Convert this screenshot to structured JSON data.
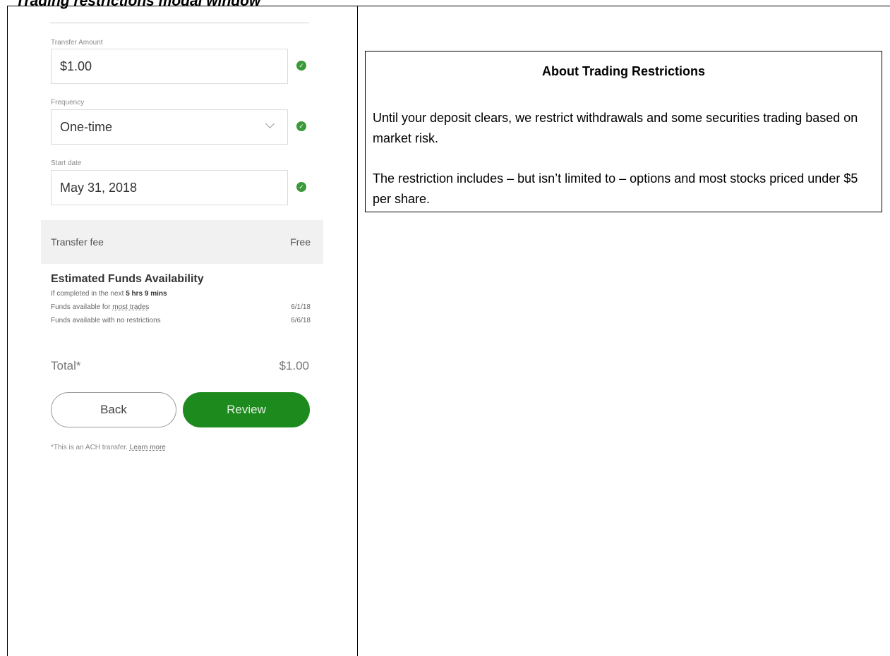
{
  "document": {
    "title": "Trading restrictions modal window"
  },
  "form": {
    "transfer_amount": {
      "label": "Transfer Amount",
      "value": "$1.00"
    },
    "frequency": {
      "label": "Frequency",
      "value": "One-time"
    },
    "start_date": {
      "label": "Start date",
      "value": "May 31, 2018"
    }
  },
  "fee": {
    "label": "Transfer fee",
    "value": "Free"
  },
  "availability": {
    "title": "Estimated Funds Availability",
    "countdown_prefix": "If completed in the next",
    "countdown_value": "5 hrs 9 mins",
    "most_trades_prefix": "Funds available for",
    "most_trades_link": "most trades",
    "most_trades_date": "6/1/18",
    "no_restrictions_label": "Funds available with no restrictions",
    "no_restrictions_date": "6/6/18"
  },
  "total": {
    "label": "Total*",
    "value": "$1.00"
  },
  "buttons": {
    "back": "Back",
    "review": "Review"
  },
  "footnote": {
    "text": "*This is an ACH transfer.",
    "link": "Learn more"
  },
  "info": {
    "title": "About Trading Restrictions",
    "paragraph1": "Until your deposit clears, we restrict withdrawals and some securities trading based on market risk.",
    "paragraph2": "The restriction includes – but isn’t limited to – options and most stocks priced under $5 per share."
  },
  "colors": {
    "accent_green": "#1d8a1d",
    "check_green": "#3a9a3a"
  },
  "icons": {
    "field_ok": "check-circle-icon",
    "dropdown": "chevron-down-icon"
  }
}
